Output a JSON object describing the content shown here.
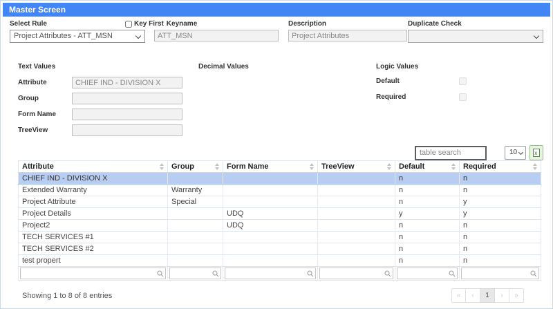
{
  "header": {
    "title": "Master Screen"
  },
  "form": {
    "select_rule": {
      "label": "Select Rule",
      "value": "Project Attributes - ATT_MSN"
    },
    "key_first": {
      "label": "Key First",
      "checked": false
    },
    "keyname": {
      "label": "Keyname",
      "value": "ATT_MSN"
    },
    "description": {
      "label": "Description",
      "value": "Project Attributes"
    },
    "duplicate_check": {
      "label": "Duplicate Check",
      "value": ""
    }
  },
  "sections": {
    "text_values": {
      "title": "Text Values",
      "fields": [
        {
          "label": "Attribute",
          "value": "CHIEF IND - DIVISION X"
        },
        {
          "label": "Group",
          "value": ""
        },
        {
          "label": "Form Name",
          "value": ""
        },
        {
          "label": "TreeView",
          "value": ""
        }
      ]
    },
    "decimal_values": {
      "title": "Decimal Values"
    },
    "logic_values": {
      "title": "Logic Values",
      "fields": [
        {
          "label": "Default",
          "checked": false
        },
        {
          "label": "Required",
          "checked": false
        }
      ]
    }
  },
  "table_controls": {
    "search_placeholder": "table search",
    "page_size": "10",
    "export_icon": "excel-export-icon"
  },
  "table": {
    "columns": [
      "Attribute",
      "Group",
      "Form Name",
      "TreeView",
      "Default",
      "Required"
    ],
    "rows": [
      {
        "attribute": "CHIEF IND - DIVISION X",
        "group": "",
        "form_name": "",
        "treeview": "",
        "default": "n",
        "required": "n",
        "selected": true
      },
      {
        "attribute": "Extended Warranty",
        "group": "Warranty",
        "form_name": "",
        "treeview": "",
        "default": "n",
        "required": "n",
        "selected": false
      },
      {
        "attribute": "Project Attribute",
        "group": "Special",
        "form_name": "",
        "treeview": "",
        "default": "n",
        "required": "y",
        "selected": false
      },
      {
        "attribute": "Project Details",
        "group": "",
        "form_name": "UDQ",
        "treeview": "",
        "default": "y",
        "required": "y",
        "selected": false
      },
      {
        "attribute": "Project2",
        "group": "",
        "form_name": "UDQ",
        "treeview": "",
        "default": "n",
        "required": "n",
        "selected": false
      },
      {
        "attribute": "TECH SERVICES #1",
        "group": "",
        "form_name": "",
        "treeview": "",
        "default": "n",
        "required": "n",
        "selected": false
      },
      {
        "attribute": "TECH SERVICES #2",
        "group": "",
        "form_name": "",
        "treeview": "",
        "default": "n",
        "required": "n",
        "selected": false
      },
      {
        "attribute": "test propert",
        "group": "",
        "form_name": "",
        "treeview": "",
        "default": "n",
        "required": "n",
        "selected": false
      }
    ]
  },
  "footer": {
    "showing_text": "Showing 1 to 8 of 8 entries",
    "pagination": {
      "first": "«",
      "prev": "‹",
      "pages": [
        "1"
      ],
      "next": "›",
      "last": "»",
      "active_page": "1"
    }
  },
  "colors": {
    "titlebar_blue": "#4285f4",
    "selected_row_blue": "#b7cdf1",
    "export_button_green": "#e9f3e4",
    "export_border_green": "#98bb8b"
  }
}
